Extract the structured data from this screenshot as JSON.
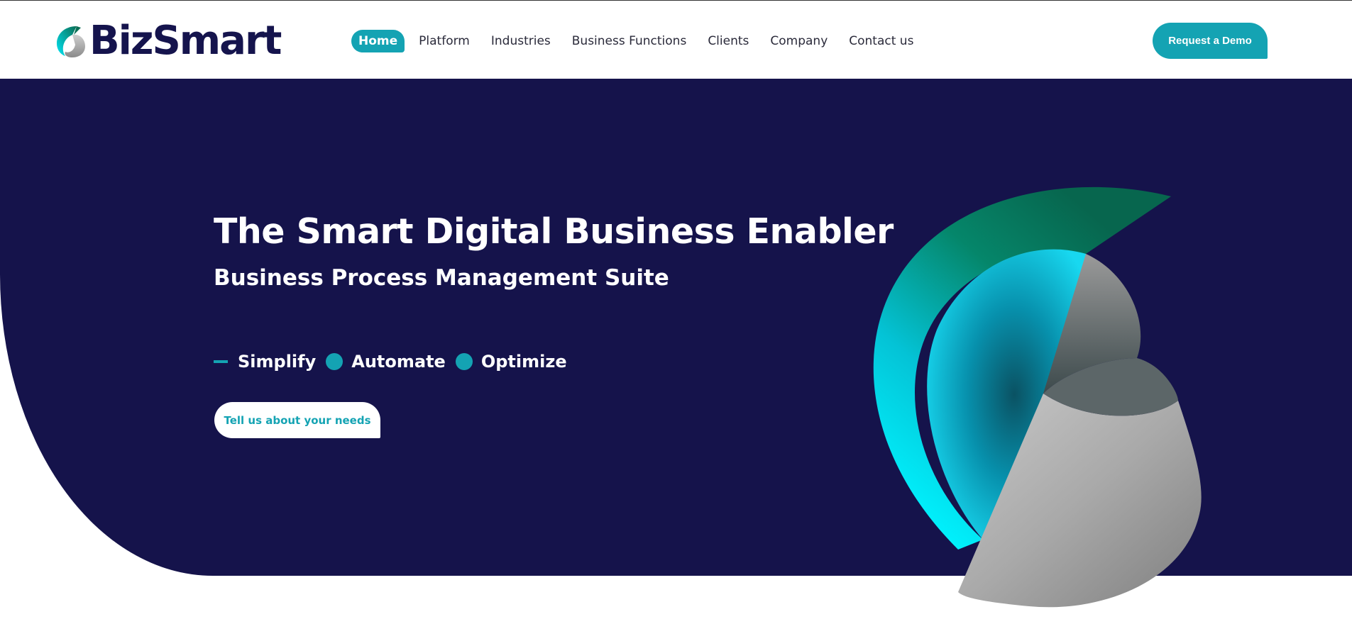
{
  "brand": {
    "name": "BizSmart",
    "logo_icon": "swirl-logo-icon"
  },
  "nav": {
    "items": [
      {
        "label": "Home",
        "active": true
      },
      {
        "label": "Platform",
        "active": false
      },
      {
        "label": "Industries",
        "active": false
      },
      {
        "label": "Business Functions",
        "active": false
      },
      {
        "label": "Clients",
        "active": false
      },
      {
        "label": "Company",
        "active": false
      },
      {
        "label": "Contact us",
        "active": false
      }
    ]
  },
  "header": {
    "cta_label": "Request a Demo"
  },
  "hero": {
    "title": "The Smart Digital Business Enabler",
    "subtitle": "Business Process Management Suite",
    "tagline": [
      "Simplify",
      "Automate",
      "Optimize"
    ],
    "cta_label": "Tell us about your needs",
    "graphic_icon": "3d-swirl-illustration"
  },
  "colors": {
    "brand_navy": "#15134b",
    "accent_teal": "#14a3b3",
    "white": "#ffffff"
  }
}
